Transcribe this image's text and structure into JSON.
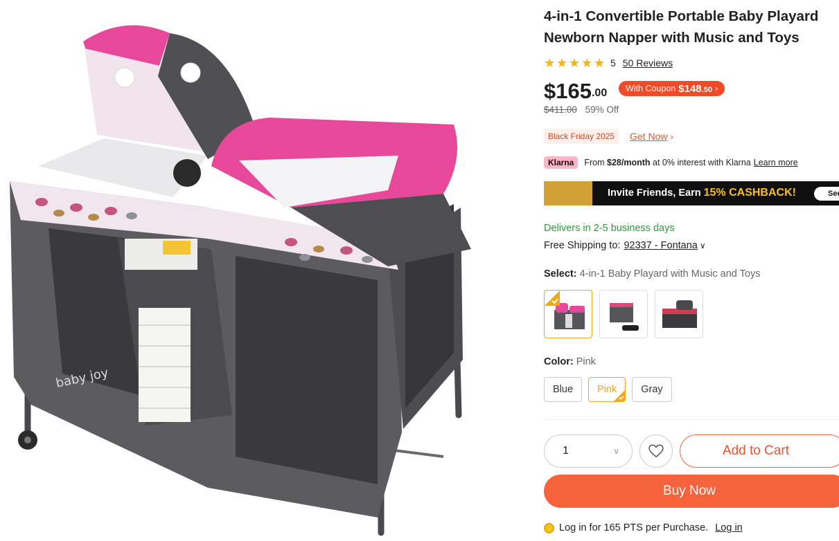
{
  "product": {
    "title": "4-in-1 Convertible Portable Baby Playard Newborn Napper with Music and Toys",
    "rating_value": "5",
    "reviews_label": "50 Reviews",
    "price_whole": "$165",
    "price_cents": ".00",
    "coupon_prefix": "With Coupon",
    "coupon_price": "$148",
    "coupon_cents": ".50",
    "original_price": "$411.00",
    "discount": "59% Off",
    "image_brand": "baby joy"
  },
  "promo": {
    "tag": "Black Friday 2025",
    "link": "Get Now"
  },
  "klarna": {
    "logo": "Klarna",
    "text_from": "From",
    "amount": "$28/month",
    "text_rest": "at 0% interest with Klarna",
    "learn_more": "Learn more"
  },
  "banner": {
    "text": "Invite Friends, Earn",
    "highlight": "15% CASHBACK!",
    "button": "See"
  },
  "delivery": {
    "delivers": "Delivers in 2-5 business days",
    "shipping_label": "Free Shipping to:",
    "zip": "92337 - Fontana"
  },
  "variant": {
    "select_label": "Select:",
    "select_value": "4-in-1 Baby Playard with Music and Toys",
    "color_label": "Color:",
    "color_value": "Pink",
    "colors": [
      "Blue",
      "Pink",
      "Gray"
    ]
  },
  "actions": {
    "quantity": "1",
    "add_to_cart": "Add to Cart",
    "buy_now": "Buy Now"
  },
  "points": {
    "text": "Log in for 165 PTS per Purchase.",
    "link": "Log in"
  },
  "colors_theme": {
    "accent": "#f5623c",
    "coupon": "#f04a27",
    "delivery_green": "#2f9b3c",
    "selected_border": "#f0a91a",
    "star": "#f7b500",
    "playard_pink": "#e8489a",
    "playard_gray": "#5a5a5e"
  }
}
